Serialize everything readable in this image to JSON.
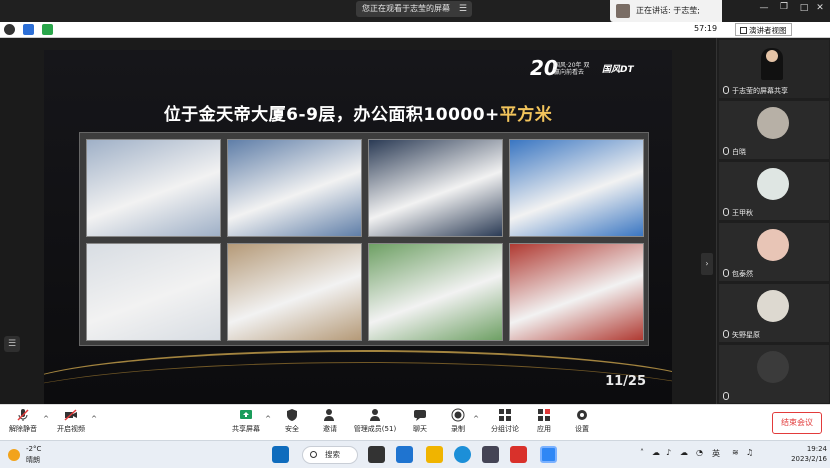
{
  "window": {
    "share_banner": "您正在观看于志莹的屏幕",
    "speaker_chip": "正在讲话: 于志莹;"
  },
  "meeting_toolbar": {
    "timer": "57:19",
    "view_label": "演讲者视图"
  },
  "slide": {
    "logo_number": "20",
    "logo_sub": "国风·20年 双赢向前看去",
    "logo_brand": "国风DT",
    "title_part1": "位于金天帝大厦6-9层，办公面积",
    "title_part2": "10000+",
    "title_part3": "平方米",
    "page": "11/25",
    "photos": [
      {
        "label": "国风 DT 大厅",
        "color": "#9fb0c7"
      },
      {
        "label": "大厅",
        "color": "#5f7ea8"
      },
      {
        "label": "走廊",
        "color": "#2b3b55"
      },
      {
        "label": "展示墙",
        "color": "#3a76c2"
      },
      {
        "label": "企业文化墙",
        "color": "#d8dde3"
      },
      {
        "label": "会议厅",
        "color": "#b59a78"
      },
      {
        "label": "办公区",
        "color": "#6ea064"
      },
      {
        "label": "会议室",
        "color": "#b03a32"
      }
    ]
  },
  "participants": [
    {
      "name": "于志莹的屏幕共享",
      "avatar_color": "#2b2b2b"
    },
    {
      "name": "白晓",
      "avatar_color": "#b7b0a6"
    },
    {
      "name": "王甲秋",
      "avatar_color": "#dfe6e3"
    },
    {
      "name": "包泰然",
      "avatar_color": "#e8c5b6"
    },
    {
      "name": "矢野星原",
      "avatar_color": "#ddd9d0"
    },
    {
      "name": "",
      "avatar_color": "#3b3b3b"
    }
  ],
  "controls": {
    "mute": "解除静音",
    "video": "开启视频",
    "share": "共享屏幕",
    "security": "安全",
    "invite": "邀请",
    "manage": "管理成员(51)",
    "chat": "聊天",
    "record": "录制",
    "breakout": "分组讨论",
    "apps": "应用",
    "settings": "设置",
    "end": "结束会议"
  },
  "taskbar": {
    "temp": "-2°C",
    "weather": "晴朗",
    "search": "搜索",
    "ime": "英",
    "time": "19:24",
    "date": "2023/2/16"
  },
  "colors": {
    "accent_red": "#e23b3b",
    "gold": "#f3c55c",
    "share_green": "#1a9c5b"
  }
}
